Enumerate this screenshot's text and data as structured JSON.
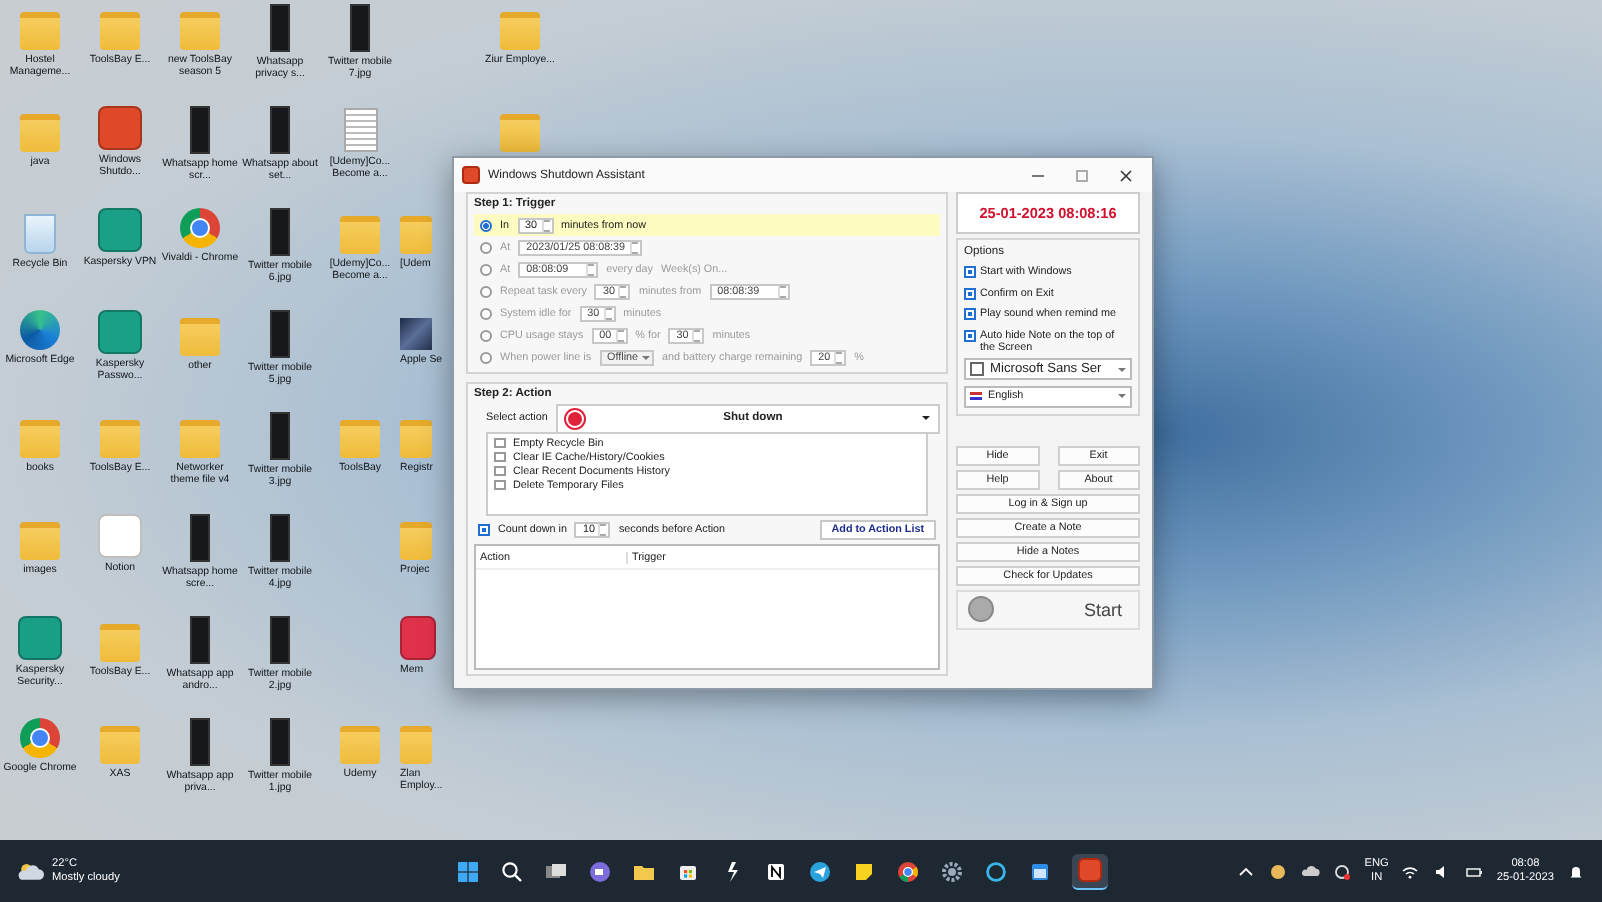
{
  "desktop_columns": [
    {
      "icons": [
        {
          "kind": "folder",
          "label": "Hostel Manageme..."
        },
        {
          "kind": "folder",
          "label": "java"
        },
        {
          "kind": "recycle",
          "label": "Recycle Bin"
        },
        {
          "kind": "edge",
          "label": "Microsoft Edge"
        },
        {
          "kind": "folder",
          "label": "books"
        },
        {
          "kind": "folder",
          "label": "images"
        },
        {
          "kind": "app",
          "color": "#1a9e86",
          "label": "Kaspersky Security..."
        },
        {
          "kind": "chrome",
          "label": "Google Chrome"
        }
      ]
    },
    {
      "icons": [
        {
          "kind": "folder",
          "label": "ToolsBay E..."
        },
        {
          "kind": "app",
          "color": "#e0482a",
          "label": "Windows Shutdo..."
        },
        {
          "kind": "app",
          "color": "#1aa086",
          "label": "Kaspersky VPN"
        },
        {
          "kind": "app",
          "color": "#1aa086",
          "label": "Kaspersky Passwo..."
        },
        {
          "kind": "folder",
          "label": "ToolsBay E..."
        },
        {
          "kind": "app",
          "color": "#ffffff",
          "label": "Notion"
        },
        {
          "kind": "folder",
          "label": "ToolsBay E..."
        },
        {
          "kind": "folder",
          "label": "XAS"
        }
      ]
    },
    {
      "icons": [
        {
          "kind": "folder",
          "label": "new ToolsBay season 5"
        },
        {
          "kind": "phone",
          "label": "Whatsapp home scr..."
        },
        {
          "kind": "chrome",
          "label": "Vivaldi - Chrome"
        },
        {
          "kind": "folder",
          "label": "other"
        },
        {
          "kind": "folder",
          "label": "Networker theme file v4"
        },
        {
          "kind": "phone",
          "label": "Whatsapp home scre..."
        },
        {
          "kind": "phone",
          "label": "Whatsapp app andro..."
        },
        {
          "kind": "phone",
          "label": "Whatsapp app priva..."
        }
      ]
    },
    {
      "icons": [
        {
          "kind": "phone",
          "label": "Whatsapp privacy s..."
        },
        {
          "kind": "phone",
          "label": "Whatsapp about set..."
        },
        {
          "kind": "phone",
          "label": "Twitter mobile 6.jpg"
        },
        {
          "kind": "phone",
          "label": "Twitter mobile 5.jpg"
        },
        {
          "kind": "phone",
          "label": "Twitter mobile 3.jpg"
        },
        {
          "kind": "phone",
          "label": "Twitter mobile 4.jpg"
        },
        {
          "kind": "phone",
          "label": "Twitter mobile 2.jpg"
        },
        {
          "kind": "phone",
          "label": "Twitter mobile 1.jpg"
        }
      ]
    },
    {
      "icons": [
        {
          "kind": "phone",
          "label": "Twitter mobile 7.jpg"
        },
        {
          "kind": "document",
          "label": "[Udemy]Co... Become a..."
        },
        {
          "kind": "folder",
          "label": "[Udemy]Co... Become a..."
        },
        {
          "kind": "empty"
        },
        {
          "kind": "folder",
          "label": "ToolsBay"
        },
        {
          "kind": "empty"
        },
        {
          "kind": "empty"
        },
        {
          "kind": "folder",
          "label": "Udemy"
        }
      ]
    },
    {
      "icons": [
        {
          "kind": "empty"
        },
        {
          "kind": "empty"
        },
        {
          "kind": "folder",
          "label": "[Udem"
        },
        {
          "kind": "photo",
          "label": "Apple Se"
        },
        {
          "kind": "folder",
          "label": "Registr"
        },
        {
          "kind": "folder",
          "label": "Projec"
        },
        {
          "kind": "app",
          "color": "#e0314a",
          "label": "Mem"
        },
        {
          "kind": "folder",
          "label": "Zlan Employ..."
        }
      ]
    },
    {
      "icons": [
        {
          "kind": "folder",
          "label": "Ziur Employe..."
        },
        {
          "kind": "folder"
        }
      ]
    }
  ],
  "window": {
    "title": "Windows Shutdown Assistant",
    "step1": {
      "title": "Step 1: Trigger",
      "rows": [
        {
          "selected": true,
          "parts": [
            {
              "kind": "text",
              "text": "In"
            },
            {
              "kind": "spin",
              "value": "30"
            },
            {
              "kind": "text",
              "text": "minutes from now"
            }
          ]
        },
        {
          "selected": false,
          "parts": [
            {
              "kind": "text",
              "text": "At"
            },
            {
              "kind": "date",
              "value": "2023/01/25  08:08:39"
            }
          ]
        },
        {
          "selected": false,
          "parts": [
            {
              "kind": "text",
              "text": "At"
            },
            {
              "kind": "date",
              "value": "08:08:09"
            },
            {
              "kind": "text",
              "text": "every day"
            },
            {
              "kind": "text",
              "text": "Week(s) On..."
            }
          ]
        },
        {
          "selected": false,
          "parts": [
            {
              "kind": "text",
              "text": "Repeat task every"
            },
            {
              "kind": "spin",
              "value": "30"
            },
            {
              "kind": "text",
              "text": "minutes from"
            },
            {
              "kind": "date",
              "value": "08:08:39"
            }
          ]
        },
        {
          "selected": false,
          "parts": [
            {
              "kind": "text",
              "text": "System idle for"
            },
            {
              "kind": "spin",
              "value": "30"
            },
            {
              "kind": "text",
              "text": "minutes"
            }
          ]
        },
        {
          "selected": false,
          "parts": [
            {
              "kind": "text",
              "text": "CPU usage stays"
            },
            {
              "kind": "spin",
              "value": "00"
            },
            {
              "kind": "text",
              "text": "% for"
            },
            {
              "kind": "spin",
              "value": "30"
            },
            {
              "kind": "text",
              "text": "minutes"
            }
          ]
        },
        {
          "selected": false,
          "parts": [
            {
              "kind": "text",
              "text": "When power line is"
            },
            {
              "kind": "combo",
              "value": "Offline"
            },
            {
              "kind": "text",
              "text": "and battery charge remaining"
            },
            {
              "kind": "spin",
              "value": "20"
            },
            {
              "kind": "text",
              "text": "%"
            }
          ]
        }
      ]
    },
    "step2": {
      "title": "Step 2: Action",
      "select_label": "Select action",
      "action": "Shut down",
      "tasks": [
        {
          "label": "Empty Recycle Bin",
          "checked": false
        },
        {
          "label": "Clear IE Cache/History/Cookies",
          "checked": false
        },
        {
          "label": "Clear Recent Documents History",
          "checked": false
        },
        {
          "label": "Delete Temporary Files",
          "checked": false
        }
      ],
      "countdown": {
        "checked": true,
        "label": "Count down in",
        "value": "10",
        "suffix": "seconds before Action"
      },
      "add_button": "Add to Action List",
      "columns": [
        "Action",
        "Trigger"
      ]
    },
    "clock": "25-01-2023 08:08:16",
    "options": {
      "title": "Options",
      "items": [
        {
          "label": "Start with Windows",
          "checked": true
        },
        {
          "label": "Confirm on Exit",
          "checked": true
        },
        {
          "label": "Play sound when remind me",
          "checked": true
        },
        {
          "label": "Auto hide Note on the top of the Screen",
          "checked": true
        }
      ]
    },
    "font": "Microsoft Sans Ser",
    "language": "English",
    "button_pairs": [
      [
        "Hide",
        "Exit"
      ],
      [
        "Help",
        "About"
      ]
    ],
    "buttons": [
      "Log in & Sign up",
      "Create a Note",
      "Hide a Notes",
      "Check for Updates"
    ],
    "start": "Start"
  },
  "taskbar": {
    "temperature": "22°C",
    "weather": "Mostly cloudy",
    "lang": "ENG",
    "region": "IN",
    "time": "08:08",
    "date": "25-01-2023"
  }
}
